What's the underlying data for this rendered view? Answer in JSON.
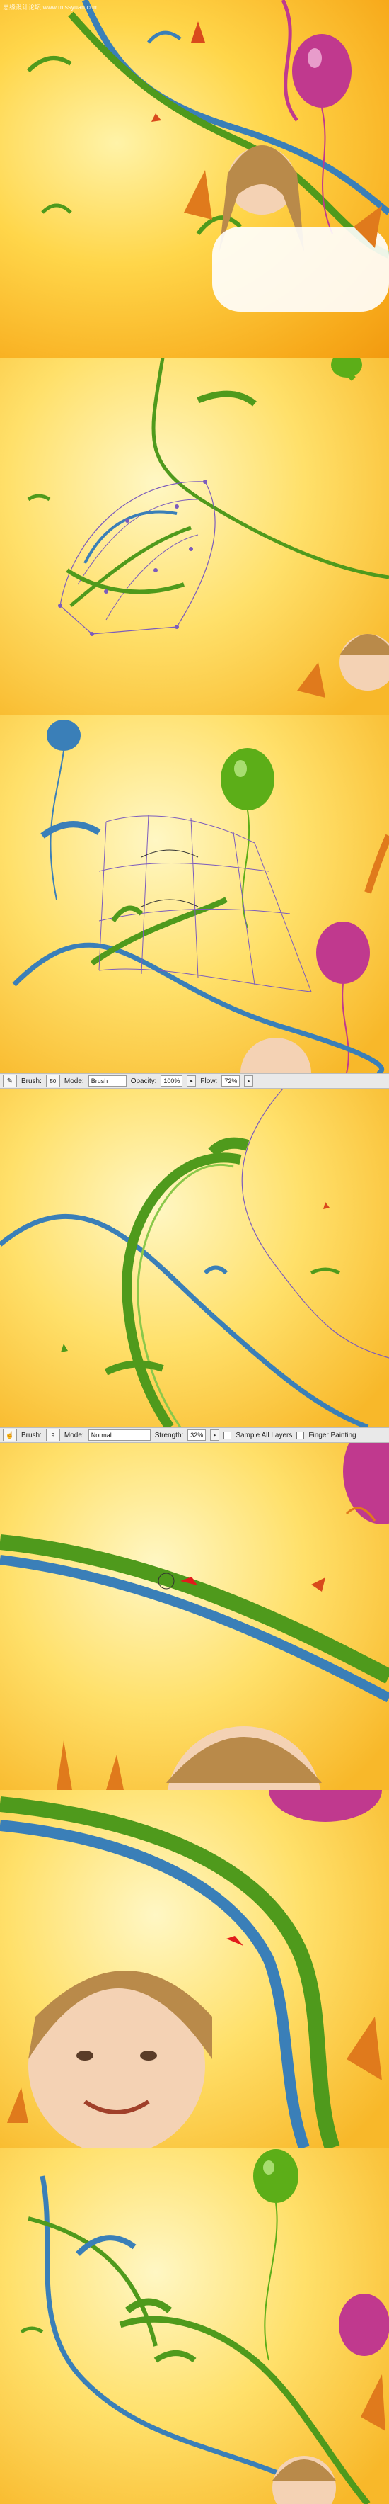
{
  "watermark": "思缘设计论坛 www.missyuan.com",
  "brush_toolbar": {
    "brush_label": "Brush:",
    "brush_size": "50",
    "mode_label": "Mode:",
    "mode_value": "Brush",
    "opacity_label": "Opacity:",
    "opacity_value": "100%",
    "flow_label": "Flow:",
    "flow_value": "72%"
  },
  "smudge_toolbar": {
    "brush_label": "Brush:",
    "brush_size": "9",
    "mode_label": "Mode:",
    "mode_value": "Normal",
    "strength_label": "Strength:",
    "strength_value": "32%",
    "sample_all_layers": "Sample All Layers",
    "finger_painting": "Finger Painting"
  },
  "colors": {
    "ribbon_green": "#4f9a1c",
    "ribbon_blue": "#3a7fb8",
    "balloon_pink": "#c0398e",
    "balloon_green": "#5cae18",
    "path_purple": "#7b5bbd",
    "arrow_red": "#e21b1b"
  }
}
